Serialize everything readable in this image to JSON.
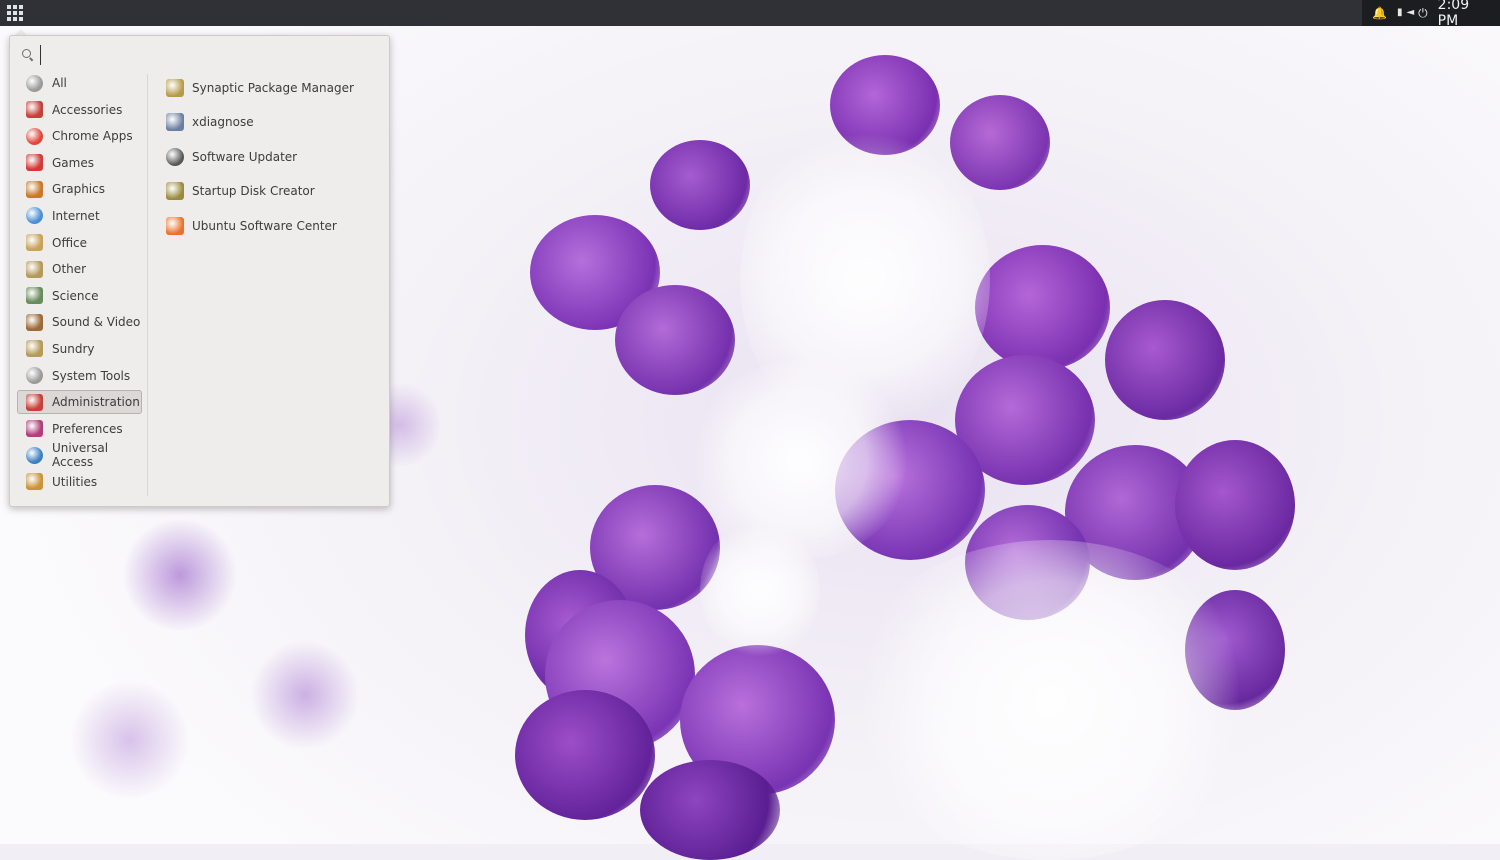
{
  "top_panel": {
    "menu_button_icon": "app-grid-icon",
    "tray_icons": [
      "bell-icon",
      "battery-icon",
      "volume-icon",
      "power-icon"
    ],
    "clock": "2:09 PM"
  },
  "app_menu": {
    "search": {
      "value": "",
      "placeholder": ""
    },
    "categories": [
      {
        "label": "All",
        "icon": "gear-icon",
        "color": "#9a9a9a"
      },
      {
        "label": "Accessories",
        "icon": "accessories-icon",
        "color": "#c8403a"
      },
      {
        "label": "Chrome Apps",
        "icon": "chrome-icon",
        "color": "#e0463a"
      },
      {
        "label": "Games",
        "icon": "games-icon",
        "color": "#d23a3a"
      },
      {
        "label": "Graphics",
        "icon": "graphics-icon",
        "color": "#c77a2c"
      },
      {
        "label": "Internet",
        "icon": "globe-icon",
        "color": "#4a8fd6"
      },
      {
        "label": "Office",
        "icon": "office-icon",
        "color": "#c9a35a"
      },
      {
        "label": "Other",
        "icon": "other-icon",
        "color": "#b59a5a"
      },
      {
        "label": "Science",
        "icon": "science-icon",
        "color": "#6a8b5c"
      },
      {
        "label": "Sound & Video",
        "icon": "sound-video-icon",
        "color": "#9c6b3a"
      },
      {
        "label": "Sundry",
        "icon": "sundry-icon",
        "color": "#b59a5a"
      },
      {
        "label": "System Tools",
        "icon": "system-tools-icon",
        "color": "#9a9a9a"
      },
      {
        "label": "Administration",
        "icon": "administration-icon",
        "color": "#c8403a",
        "selected": true
      },
      {
        "label": "Preferences",
        "icon": "preferences-icon",
        "color": "#b0407a"
      },
      {
        "label": "Universal Access",
        "icon": "universal-access-icon",
        "color": "#3b7fc4"
      },
      {
        "label": "Utilities",
        "icon": "utilities-icon",
        "color": "#c9953a"
      }
    ],
    "apps": [
      {
        "label": "Synaptic Package Manager",
        "icon": "synaptic-icon",
        "color": "#b59a4a"
      },
      {
        "label": "xdiagnose",
        "icon": "xdiagnose-icon",
        "color": "#6a7fa0"
      },
      {
        "label": "Software Updater",
        "icon": "software-updater-icon",
        "color": "#555555"
      },
      {
        "label": "Startup Disk Creator",
        "icon": "startup-disk-icon",
        "color": "#9a8a3a"
      },
      {
        "label": "Ubuntu Software Center",
        "icon": "software-center-icon",
        "color": "#e8722c"
      }
    ]
  }
}
